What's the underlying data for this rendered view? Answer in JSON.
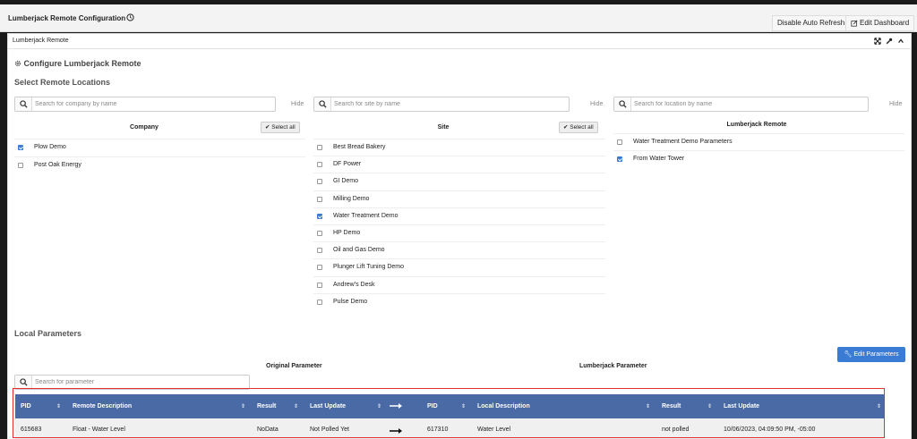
{
  "header": {
    "title": "Lumberjack Remote Configuration",
    "disable_refresh": "Disable Auto Refresh",
    "edit_dashboard": "Edit Dashboard"
  },
  "panel": {
    "title": "Lumberjack Remote",
    "configure_heading": "Configure Lumberjack Remote",
    "select_heading": "Select Remote Locations"
  },
  "company": {
    "placeholder": "Search for company by name",
    "hide": "Hide",
    "title": "Company",
    "select_all": "Select all",
    "items": [
      {
        "label": "Plow Demo",
        "checked": true
      },
      {
        "label": "Post Oak Energy",
        "checked": false
      }
    ]
  },
  "site": {
    "placeholder": "Search for site by name",
    "hide": "Hide",
    "title": "Site",
    "select_all": "Select all",
    "items": [
      {
        "label": "Best Bread Bakery",
        "checked": false
      },
      {
        "label": "DF Power",
        "checked": false
      },
      {
        "label": "GI Demo",
        "checked": false
      },
      {
        "label": "Milling Demo",
        "checked": false
      },
      {
        "label": "Water Treatment Demo",
        "checked": true
      },
      {
        "label": "HP Demo",
        "checked": false
      },
      {
        "label": "Oil and Gas Demo",
        "checked": false
      },
      {
        "label": "Plunger Lift Tuning Demo",
        "checked": false
      },
      {
        "label": "Andrew's Desk",
        "checked": false
      },
      {
        "label": "Pulse Demo",
        "checked": false
      }
    ]
  },
  "remote": {
    "placeholder": "Search for location by name",
    "hide": "Hide",
    "title": "Lumberjack Remote",
    "items": [
      {
        "label": "Water Treatment Demo Parameters",
        "checked": false
      },
      {
        "label": "From Water Tower",
        "checked": true
      }
    ]
  },
  "local": {
    "heading": "Local Parameters",
    "edit_button": "Edit Parameters",
    "original_title": "Original Parameter",
    "lumberjack_title": "Lumberjack Parameter",
    "search_placeholder": "Search for parameter",
    "columns": {
      "pid": "PID",
      "remote_description": "Remote Description",
      "result": "Result",
      "last_update": "Last Update",
      "pid2": "PID",
      "local_description": "Local Description",
      "result2": "Result",
      "last_update2": "Last Update"
    },
    "row": {
      "pid": "615683",
      "remote_description": "Float - Water Level",
      "result": "NoData",
      "last_update": "Not Polled Yet",
      "pid2": "617310",
      "local_description": "Water Level",
      "result2": "not polled",
      "last_update2": "10/06/2023, 04:09:50 PM, -05:00"
    }
  },
  "colors": {
    "accent": "#3a7bd5",
    "table_header": "#4a6aa5",
    "highlight": "#e03030"
  }
}
